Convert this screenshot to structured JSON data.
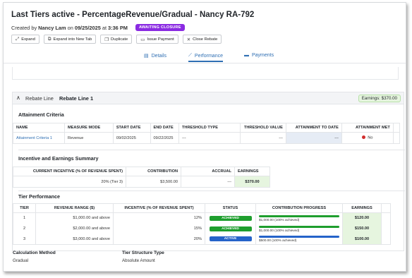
{
  "header": {
    "title": "Last Tiers active - PercentageRevenue/Gradual - Nancy RA-792",
    "created_prefix": "Created by",
    "created_by": "Nancy Lam",
    "created_on_prefix": "on",
    "created_date": "09/25/2025",
    "created_at_prefix": "at",
    "created_time": "3:36 PM",
    "status_badge": "AWAITING CLOSURE",
    "status_color": "#8a2be2"
  },
  "actions": [
    {
      "label": "Expand",
      "icon": "expand-icon"
    },
    {
      "label": "Expand into New Tab",
      "icon": "new-tab-icon"
    },
    {
      "label": "Duplicate",
      "icon": "duplicate-icon"
    },
    {
      "label": "Issue Payment",
      "icon": "payment-icon"
    },
    {
      "label": "Close Rebate",
      "icon": "close-icon"
    }
  ],
  "tabs": [
    {
      "label": "Details",
      "icon": "details-icon",
      "active": false
    },
    {
      "label": "Performance",
      "icon": "trend-icon",
      "active": true
    },
    {
      "label": "Payments",
      "icon": "card-icon",
      "active": false
    }
  ],
  "rebate_line": {
    "label": "Rebate Line",
    "name": "Rebate Line 1",
    "earnings": "Earnings: $370.00"
  },
  "attainment": {
    "title": "Attainment Criteria",
    "columns": [
      "NAME",
      "MEASURE MODE",
      "START DATE",
      "END DATE",
      "THRESHOLD TYPE",
      "THRESHOLD VALUE",
      "ATTAINMENT TO DATE",
      "ATTAINMENT MET"
    ],
    "rows": [
      {
        "name": "Attainment Criteria 1",
        "measure_mode": "Revenue",
        "start_date": "09/02/2025",
        "end_date": "09/22/2025",
        "threshold_type": "---",
        "threshold_value": "---",
        "attainment_to_date": "---",
        "attainment_met": "No"
      }
    ]
  },
  "incentive": {
    "title": "Incentive and Earnings Summary",
    "columns": [
      "CURRENT INCENTIVE (% OF REVENUE SPENT)",
      "CONTRIBUTION",
      "ACCRUAL",
      "EARNINGS"
    ],
    "row": {
      "current_incentive": "20% (Tier 3)",
      "contribution": "$3,500.00",
      "accrual": "---",
      "earnings": "$370.00"
    }
  },
  "tiers": {
    "title": "Tier Performance",
    "columns": [
      "TIER",
      "REVENUE RANGE ($)",
      "INCENTIVE (% OF REVENUE SPENT)",
      "STATUS",
      "CONTRIBUTION PROGRESS",
      "EARNINGS"
    ],
    "rows": [
      {
        "tier": "1",
        "range": "$1,000.00 and above",
        "incentive": "12%",
        "status": "ACHIEVED",
        "status_color": "#1e9e2e",
        "progress": "$1,000.00 (100% achieved)",
        "progress_fraction": 1.0,
        "bar_color": "#1e9e2e",
        "earnings": "$120.00"
      },
      {
        "tier": "2",
        "range": "$2,000.00 and above",
        "incentive": "15%",
        "status": "ACHIEVED",
        "status_color": "#1e9e2e",
        "progress": "$1,000.00 (100% achieved)",
        "progress_fraction": 1.0,
        "bar_color": "#1e9e2e",
        "earnings": "$150.00"
      },
      {
        "tier": "3",
        "range": "$3,000.00 and above",
        "incentive": "20%",
        "status": "ACTIVE",
        "status_color": "#2563c9",
        "progress": "$500.00 (100% achieved)",
        "progress_fraction": 1.0,
        "bar_color": "#2563c9",
        "earnings": "$100.00"
      }
    ]
  },
  "footer": {
    "calc_label": "Calculation Method",
    "calc_value": "Gradual",
    "structure_label": "Tier Structure Type",
    "structure_value": "Absolute Amount"
  }
}
